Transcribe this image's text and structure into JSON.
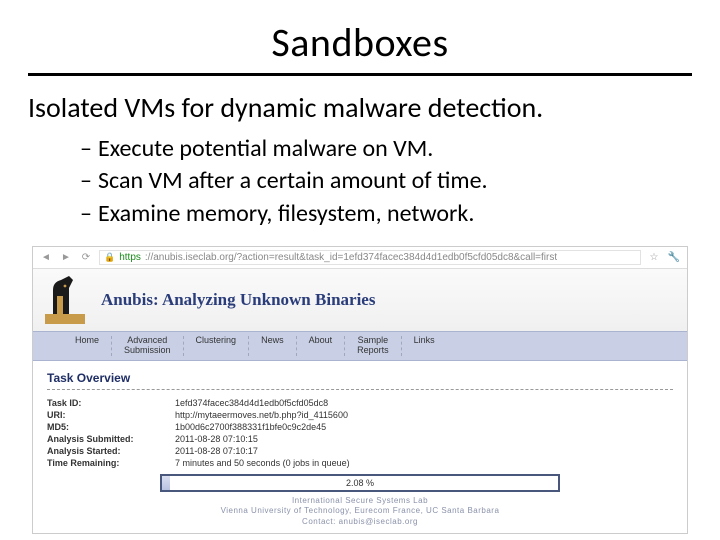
{
  "title": "Sandboxes",
  "subtitle": "Isolated VMs for dynamic malware detection.",
  "bullets": [
    "Execute potential malware on VM.",
    "Scan VM after a certain amount of time.",
    "Examine memory, filesystem, network."
  ],
  "browser": {
    "scheme": "https",
    "url": "://anubis.iseclab.org/?action=result&task_id=1efd374facec384d4d1edb0f5cfd05dc8&call=first"
  },
  "brand": "Anubis: Analyzing Unknown Binaries",
  "menu": [
    "Home",
    "Advanced\nSubmission",
    "Clustering",
    "News",
    "About",
    "Sample\nReports",
    "Links"
  ],
  "task_header": "Task Overview",
  "kv": [
    {
      "k": "Task ID:",
      "v": "1efd374facec384d4d1edb0f5cfd05dc8"
    },
    {
      "k": "URI:",
      "v": "http://mytaeermoves.net/b.php?id_4115600"
    },
    {
      "k": "MD5:",
      "v": "1b00d6c2700f388331f1bfe0c9c2de45"
    },
    {
      "k": "Analysis Submitted:",
      "v": "2011-08-28 07:10:15"
    },
    {
      "k": "Analysis Started:",
      "v": "2011-08-28 07:10:17"
    },
    {
      "k": "Time Remaining:",
      "v": "7 minutes and 50 seconds (0 jobs in queue)"
    }
  ],
  "progress": {
    "percent": 2.08,
    "label": "2.08 %"
  },
  "footer_lines": [
    "International Secure Systems Lab",
    "Vienna University of Technology, Eurecom France, UC Santa Barbara",
    "Contact: anubis@iseclab.org"
  ]
}
